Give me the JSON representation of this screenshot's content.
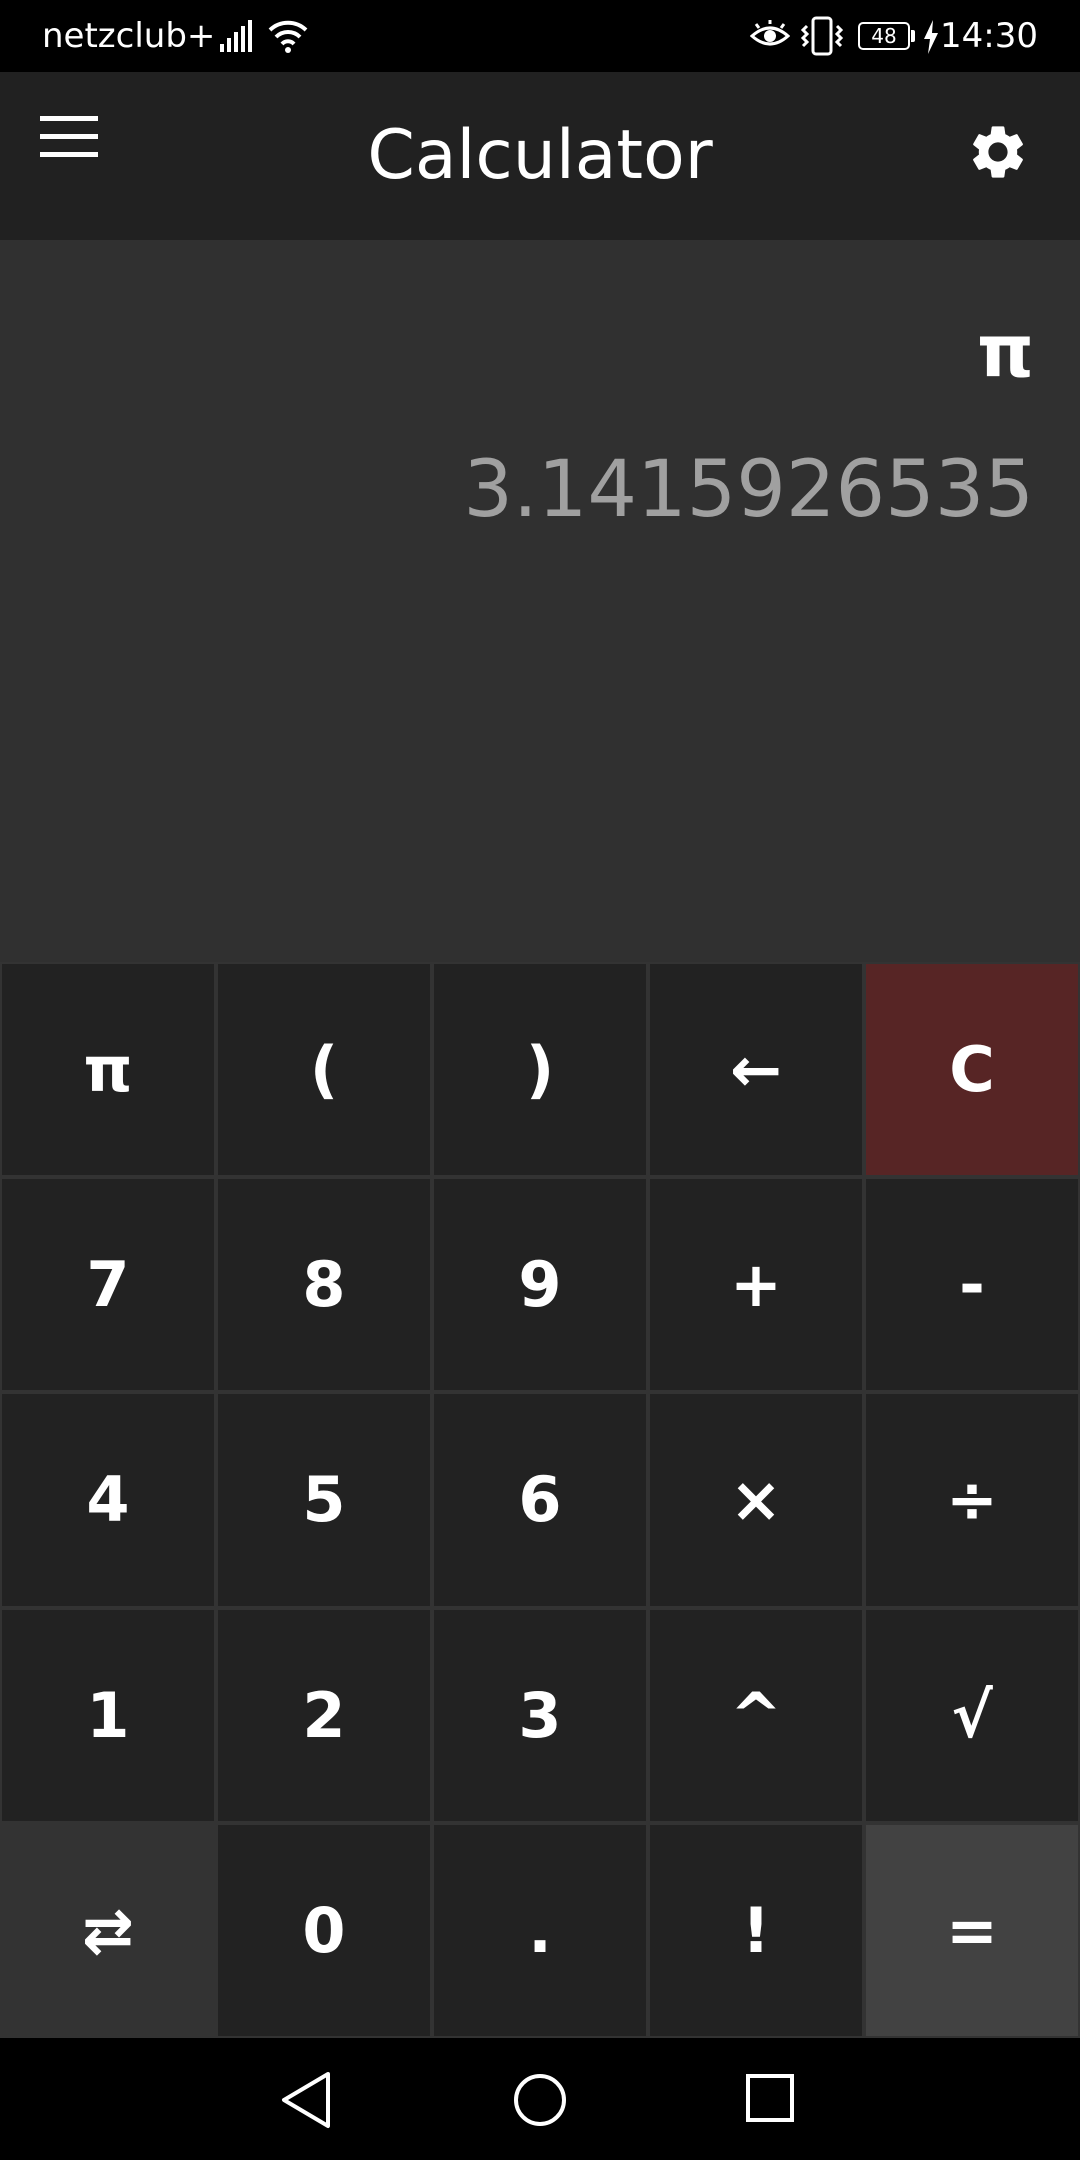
{
  "status_bar": {
    "carrier": "netzclub+",
    "battery_level": "48",
    "time": "14:30",
    "icons": [
      "signal-icon",
      "wifi-icon",
      "eye-icon",
      "vibrate-icon",
      "battery-icon",
      "charging-icon"
    ]
  },
  "app_bar": {
    "title": "Calculator",
    "menu_icon": "hamburger-menu-icon",
    "settings_icon": "gear-icon"
  },
  "display": {
    "expression": "π",
    "result": "3.1415926535"
  },
  "keypad": {
    "rows": [
      [
        "π",
        "(",
        ")",
        "←",
        "C"
      ],
      [
        "7",
        "8",
        "9",
        "+",
        "-"
      ],
      [
        "4",
        "5",
        "6",
        "×",
        "÷"
      ],
      [
        "1",
        "2",
        "3",
        "^",
        "√"
      ],
      [
        "⇄",
        "0",
        ".",
        "!",
        "="
      ]
    ]
  },
  "colors": {
    "app_bar": "#212121",
    "display": "#303030",
    "key": "#222222",
    "clear_key": "#572525",
    "equals_key": "#424242",
    "result_text": "#a0a0a0"
  },
  "nav_bar": {
    "icons": [
      "back-icon",
      "home-icon",
      "recent-apps-icon"
    ]
  }
}
